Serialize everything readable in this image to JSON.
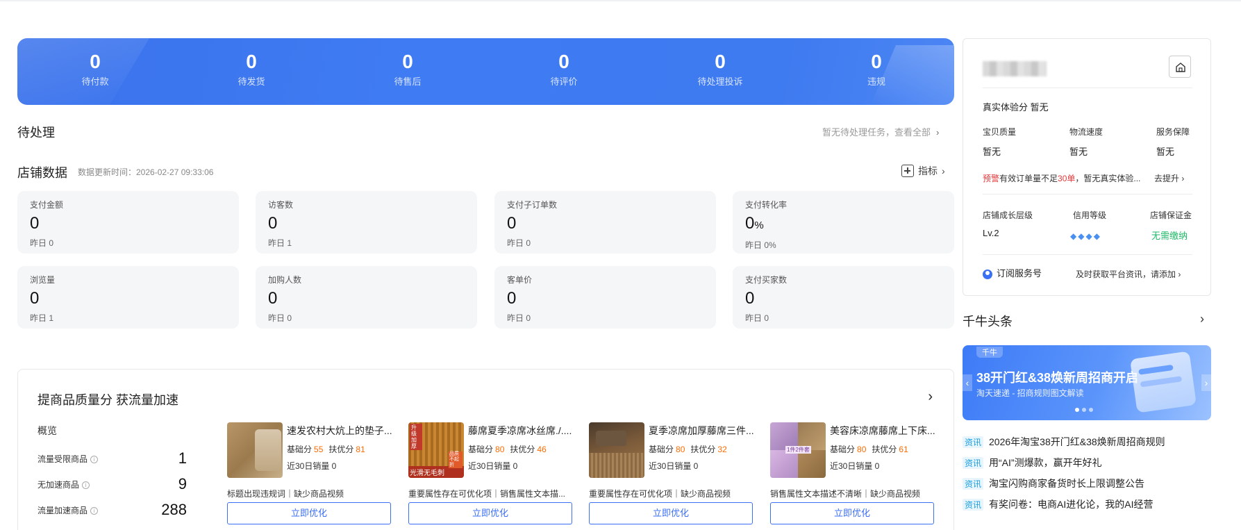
{
  "banner": {
    "stats": [
      {
        "value": "0",
        "label": "待付款"
      },
      {
        "value": "0",
        "label": "待发货"
      },
      {
        "value": "0",
        "label": "待售后"
      },
      {
        "value": "0",
        "label": "待评价"
      },
      {
        "value": "0",
        "label": "待处理投诉"
      },
      {
        "value": "0",
        "label": "违规"
      }
    ]
  },
  "pending": {
    "title": "待处理",
    "hint": "暂无待处理任务，查看全部"
  },
  "store_data": {
    "title": "店铺数据",
    "update_time": "数据更新时间：2026-02-27 09:33:06",
    "indicator_label": "指标",
    "metrics": [
      {
        "label": "支付金额",
        "value": "0",
        "yesterday": "昨日 0"
      },
      {
        "label": "访客数",
        "value": "0",
        "yesterday": "昨日 1"
      },
      {
        "label": "支付子订单数",
        "value": "0",
        "yesterday": "昨日 0"
      },
      {
        "label": "支付转化率",
        "value": "0",
        "unit": "%",
        "yesterday": "昨日 0%"
      },
      {
        "label": "浏览量",
        "value": "0",
        "yesterday": "昨日 1"
      },
      {
        "label": "加购人数",
        "value": "0",
        "yesterday": "昨日 0"
      },
      {
        "label": "客单价",
        "value": "0",
        "yesterday": "昨日 0"
      },
      {
        "label": "支付买家数",
        "value": "0",
        "yesterday": "昨日 0"
      }
    ]
  },
  "quality": {
    "title": "提商品质量分 获流量加速",
    "overview_title": "概览",
    "overview": [
      {
        "label": "流量受限商品",
        "value": "1"
      },
      {
        "label": "无加速商品",
        "value": "9"
      },
      {
        "label": "流量加速商品",
        "value": "288"
      }
    ],
    "base_label": "基础分",
    "boost_label": "扶优分",
    "products": [
      {
        "name": "速发农村大炕上的垫子...",
        "base": "55",
        "boost": "81",
        "sales": "近30日销量 0",
        "issue": "标题出现违规词｜缺少商品视频",
        "button": "立即优化"
      },
      {
        "name": "藤席夏季凉席冰丝席./....",
        "base": "80",
        "boost": "46",
        "sales": "近30日销量 0",
        "issue": "重要属性存在可优化项｜销售属性文本描...",
        "button": "立即优化",
        "thumb_text_top": "升级加厚",
        "thumb_text_bottom": "光滑无毛刺",
        "thumb_text_side": "品质不起折"
      },
      {
        "name": "夏季凉席加厚藤席三件...",
        "base": "80",
        "boost": "32",
        "sales": "近30日销量 0",
        "issue": "重要属性存在可优化项｜缺少商品视频",
        "button": "立即优化"
      },
      {
        "name": "美容床凉席藤席上下床...",
        "base": "80",
        "boost": "61",
        "sales": "近30日销量 0",
        "issue": "销售属性文本描述不清晰｜缺少商品视频",
        "button": "立即优化",
        "thumb_text": "1件2件套"
      }
    ]
  },
  "shop_card": {
    "real_score_label": "真实体验分",
    "real_score_value": "暂无",
    "dimensions": [
      {
        "label": "宝贝质量",
        "value": "暂无"
      },
      {
        "label": "物流速度",
        "value": "暂无"
      },
      {
        "label": "服务保障",
        "value": "暂无"
      }
    ],
    "warning_tag": "预警",
    "warning_text_a": "有效订单量不足",
    "warning_num": "30单",
    "warning_text_b": "，暂无真实体验...",
    "warning_action": "去提升",
    "growth_label": "店铺成长层级",
    "growth_value": "Lv.2",
    "credit_label": "信用等级",
    "deposit_label": "店铺保证金",
    "deposit_value": "无需缴纳",
    "subscribe_label": "订阅服务号",
    "subscribe_hint": "及时获取平台资讯，请添加"
  },
  "headlines": {
    "title": "千牛头条",
    "promo_tag": "千牛",
    "promo_title": "38开门红&38焕新周招商开启",
    "promo_sub": "淘天速递 - 招商规则图文解读",
    "news_tag": "资讯",
    "news": [
      "2026年淘宝38开门红&38焕新周招商规则",
      "用“AI”测爆款，赢开年好礼",
      "淘宝闪购商家备货时长上限调整公告",
      "有奖问卷：电商AI进化论，我的AI经营"
    ]
  },
  "colors": {
    "banner": "#3f7bf2",
    "accent": "#3b6ff5",
    "score_orange": "#ff6a00",
    "warning_red": "#e4393c",
    "deposit_green": "#1fb868"
  },
  "icons": [
    "store-icon",
    "plus-box-icon",
    "chevron-right-icon",
    "info-icon",
    "diamond-icon",
    "subscribe-user-icon"
  ]
}
